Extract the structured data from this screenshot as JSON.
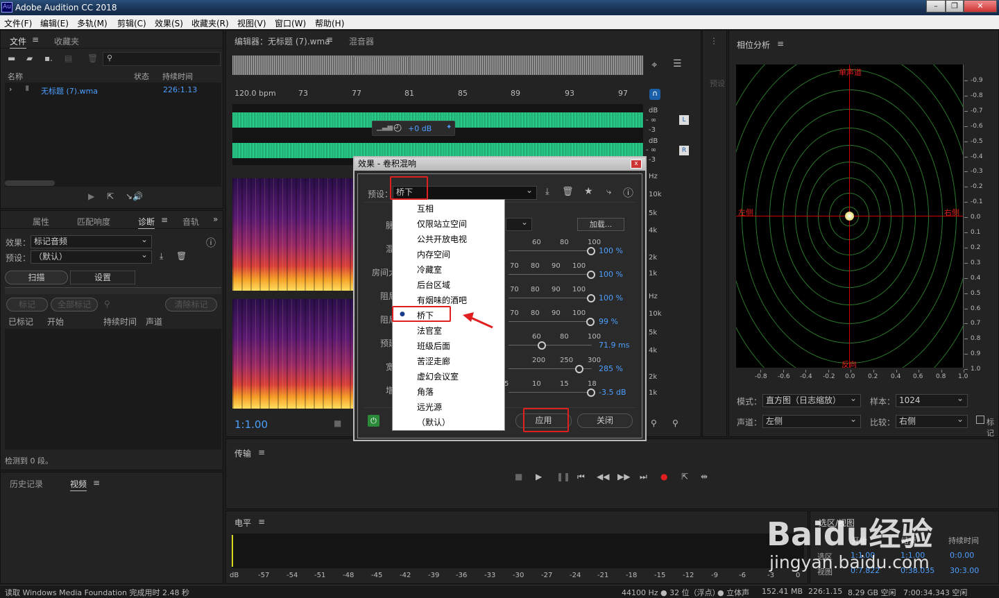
{
  "app": {
    "title": "Adobe Audition CC 2018",
    "logo": "Au"
  },
  "window_controls": {
    "minimize": "–",
    "restore": "❐",
    "close": "✕"
  },
  "menu": [
    "文件(F)",
    "编辑(E)",
    "多轨(M)",
    "剪辑(C)",
    "效果(S)",
    "收藏夹(R)",
    "视图(V)",
    "窗口(W)",
    "帮助(H)"
  ],
  "files_panel": {
    "tabs": [
      "文件",
      "收藏夹"
    ],
    "cols": {
      "name": "名称",
      "status": "状态",
      "duration": "持续时间"
    },
    "file": {
      "name": "无标题 (7).wma",
      "duration": "226:1.13"
    }
  },
  "diag_panel": {
    "tabs": [
      "属性",
      "匹配响度",
      "诊断",
      "音轨"
    ],
    "effect_label": "效果：",
    "effect_value": "标记音频",
    "preset_label": "预设：",
    "preset_value": "（默认）",
    "scan": "扫描",
    "settings": "设置",
    "mark": "标记",
    "mark_all": "全部标记",
    "clear_marks": "清除标记",
    "cols": {
      "marked": "已标记",
      "start": "开始",
      "duration": "持续时间",
      "channel": "声道"
    },
    "status": "检测到 0 段。"
  },
  "bottom_left": {
    "tabs": [
      "历史记录",
      "视频"
    ]
  },
  "editor": {
    "tab": "编辑器：无标题 (7).wma",
    "mixer": "混音器",
    "bpm": "120.0 bpm",
    "ruler": [
      "73",
      "77",
      "81",
      "85",
      "89",
      "93",
      "97"
    ],
    "volume": "+0 dB",
    "time": "1:1.00",
    "db_labels": [
      "dB",
      "- ∞",
      "-3",
      "dB",
      "- ∞",
      "-3"
    ],
    "ch_left": "L",
    "ch_right": "R",
    "hz": [
      "Hz",
      "10k",
      "5k",
      "4k",
      "2k",
      "1k",
      "Hz",
      "10k",
      "5k",
      "4k",
      "2k",
      "1k"
    ]
  },
  "side_panel": {
    "label": "预设"
  },
  "dialog": {
    "title": "效果 - 卷积混响",
    "preset_label": "预设：",
    "preset_value": "桥下",
    "load": "加载...",
    "apply": "应用",
    "close": "关闭",
    "rows": [
      {
        "label": "脉",
        "ticks": []
      },
      {
        "label": "混",
        "ticks": [
          "60",
          "80",
          "100"
        ],
        "value": "100 %"
      },
      {
        "label": "房间大",
        "ticks": [
          "60",
          "70",
          "80",
          "90",
          "100"
        ],
        "value": "100 %"
      },
      {
        "label": "阻尼",
        "ticks": [
          "60",
          "70",
          "80",
          "90",
          "100"
        ],
        "value": "100 %"
      },
      {
        "label": "阻尼",
        "ticks": [
          "60",
          "70",
          "80",
          "90",
          "100"
        ],
        "value": "99 %"
      },
      {
        "label": "预延",
        "ticks": [
          "60",
          "80",
          "100"
        ],
        "value": "71.9 ms"
      },
      {
        "label": "宽",
        "ticks": [
          "200",
          "250",
          "300"
        ],
        "value": "285 %"
      },
      {
        "label": "增",
        "ticks": [
          "5",
          "10",
          "15",
          "18"
        ],
        "value": "-3.5 dB"
      }
    ],
    "presets": [
      "互相",
      "仅限站立空间",
      "公共开放电视",
      "内存空间",
      "冷藏室",
      "后台区域",
      "有烟味的酒吧",
      "桥下",
      "法官室",
      "班级后面",
      "苦涩走廊",
      "虚幻会议室",
      "角落",
      "远光源",
      "（默认）"
    ]
  },
  "phase": {
    "title": "相位分析",
    "top": "单声道",
    "left": "左侧",
    "right": "右侧",
    "bottom": "反向",
    "yaxis": [
      "-0.9",
      "-0.8",
      "-0.7",
      "-0.6",
      "-0.5",
      "-0.4",
      "-0.3",
      "-0.2",
      "-0.1",
      "0.0",
      "0.1",
      "0.2",
      "0.3",
      "0.4",
      "0.5",
      "0.6",
      "0.7",
      "0.8",
      "0.9",
      "1.0"
    ],
    "xaxis": [
      "-0.8",
      "-0.6",
      "-0.4",
      "-0.2",
      "0.0",
      "0.2",
      "0.4",
      "0.6",
      "0.8",
      "1.0"
    ],
    "mode_label": "模式：",
    "mode": "直方图（日志缩放）",
    "sample_label": "样本：",
    "sample": "1024",
    "channel_label": "声道：",
    "channel": "左侧",
    "compare_label": "比较：",
    "compare": "右侧",
    "mark": "标记"
  },
  "transport": {
    "title": "传输"
  },
  "levels": {
    "title": "电平",
    "scale": [
      "dB",
      "-57",
      "-54",
      "-51",
      "-48",
      "-45",
      "-42",
      "-39",
      "-36",
      "-33",
      "-30",
      "-27",
      "-24",
      "-21",
      "-18",
      "-15",
      "-12",
      "-9",
      "-6",
      "-3",
      "0"
    ]
  },
  "selection": {
    "title": "选区/视图",
    "cols": [
      "开始",
      "结束",
      "持续时间"
    ],
    "rows": [
      {
        "label": "选区",
        "start": "1:1.00",
        "end": "1:1.00",
        "dur": "0:0.00"
      },
      {
        "label": "视图",
        "start": "0:7.822",
        "end": "0:38.035",
        "dur": "30:3.00"
      }
    ]
  },
  "status": {
    "left": "读取 Windows Media Foundation 完成用时 2.48 秒",
    "rate": "44100 Hz ● 32 位（浮点）",
    "stereo": "● 立体声",
    "size": "152.41 MB",
    "dur": "226:1.15",
    "free": "8.29 GB 空闲",
    "time": "7:00:34.343 空闲"
  },
  "watermark": {
    "brand": "Baidu经验",
    "url": "jingyan.baidu.com"
  },
  "colors": {
    "waveform": "#2ad690",
    "accent": "#4d9fff",
    "highlight": "#e02020",
    "phase_grid": "#2a7a2a"
  }
}
